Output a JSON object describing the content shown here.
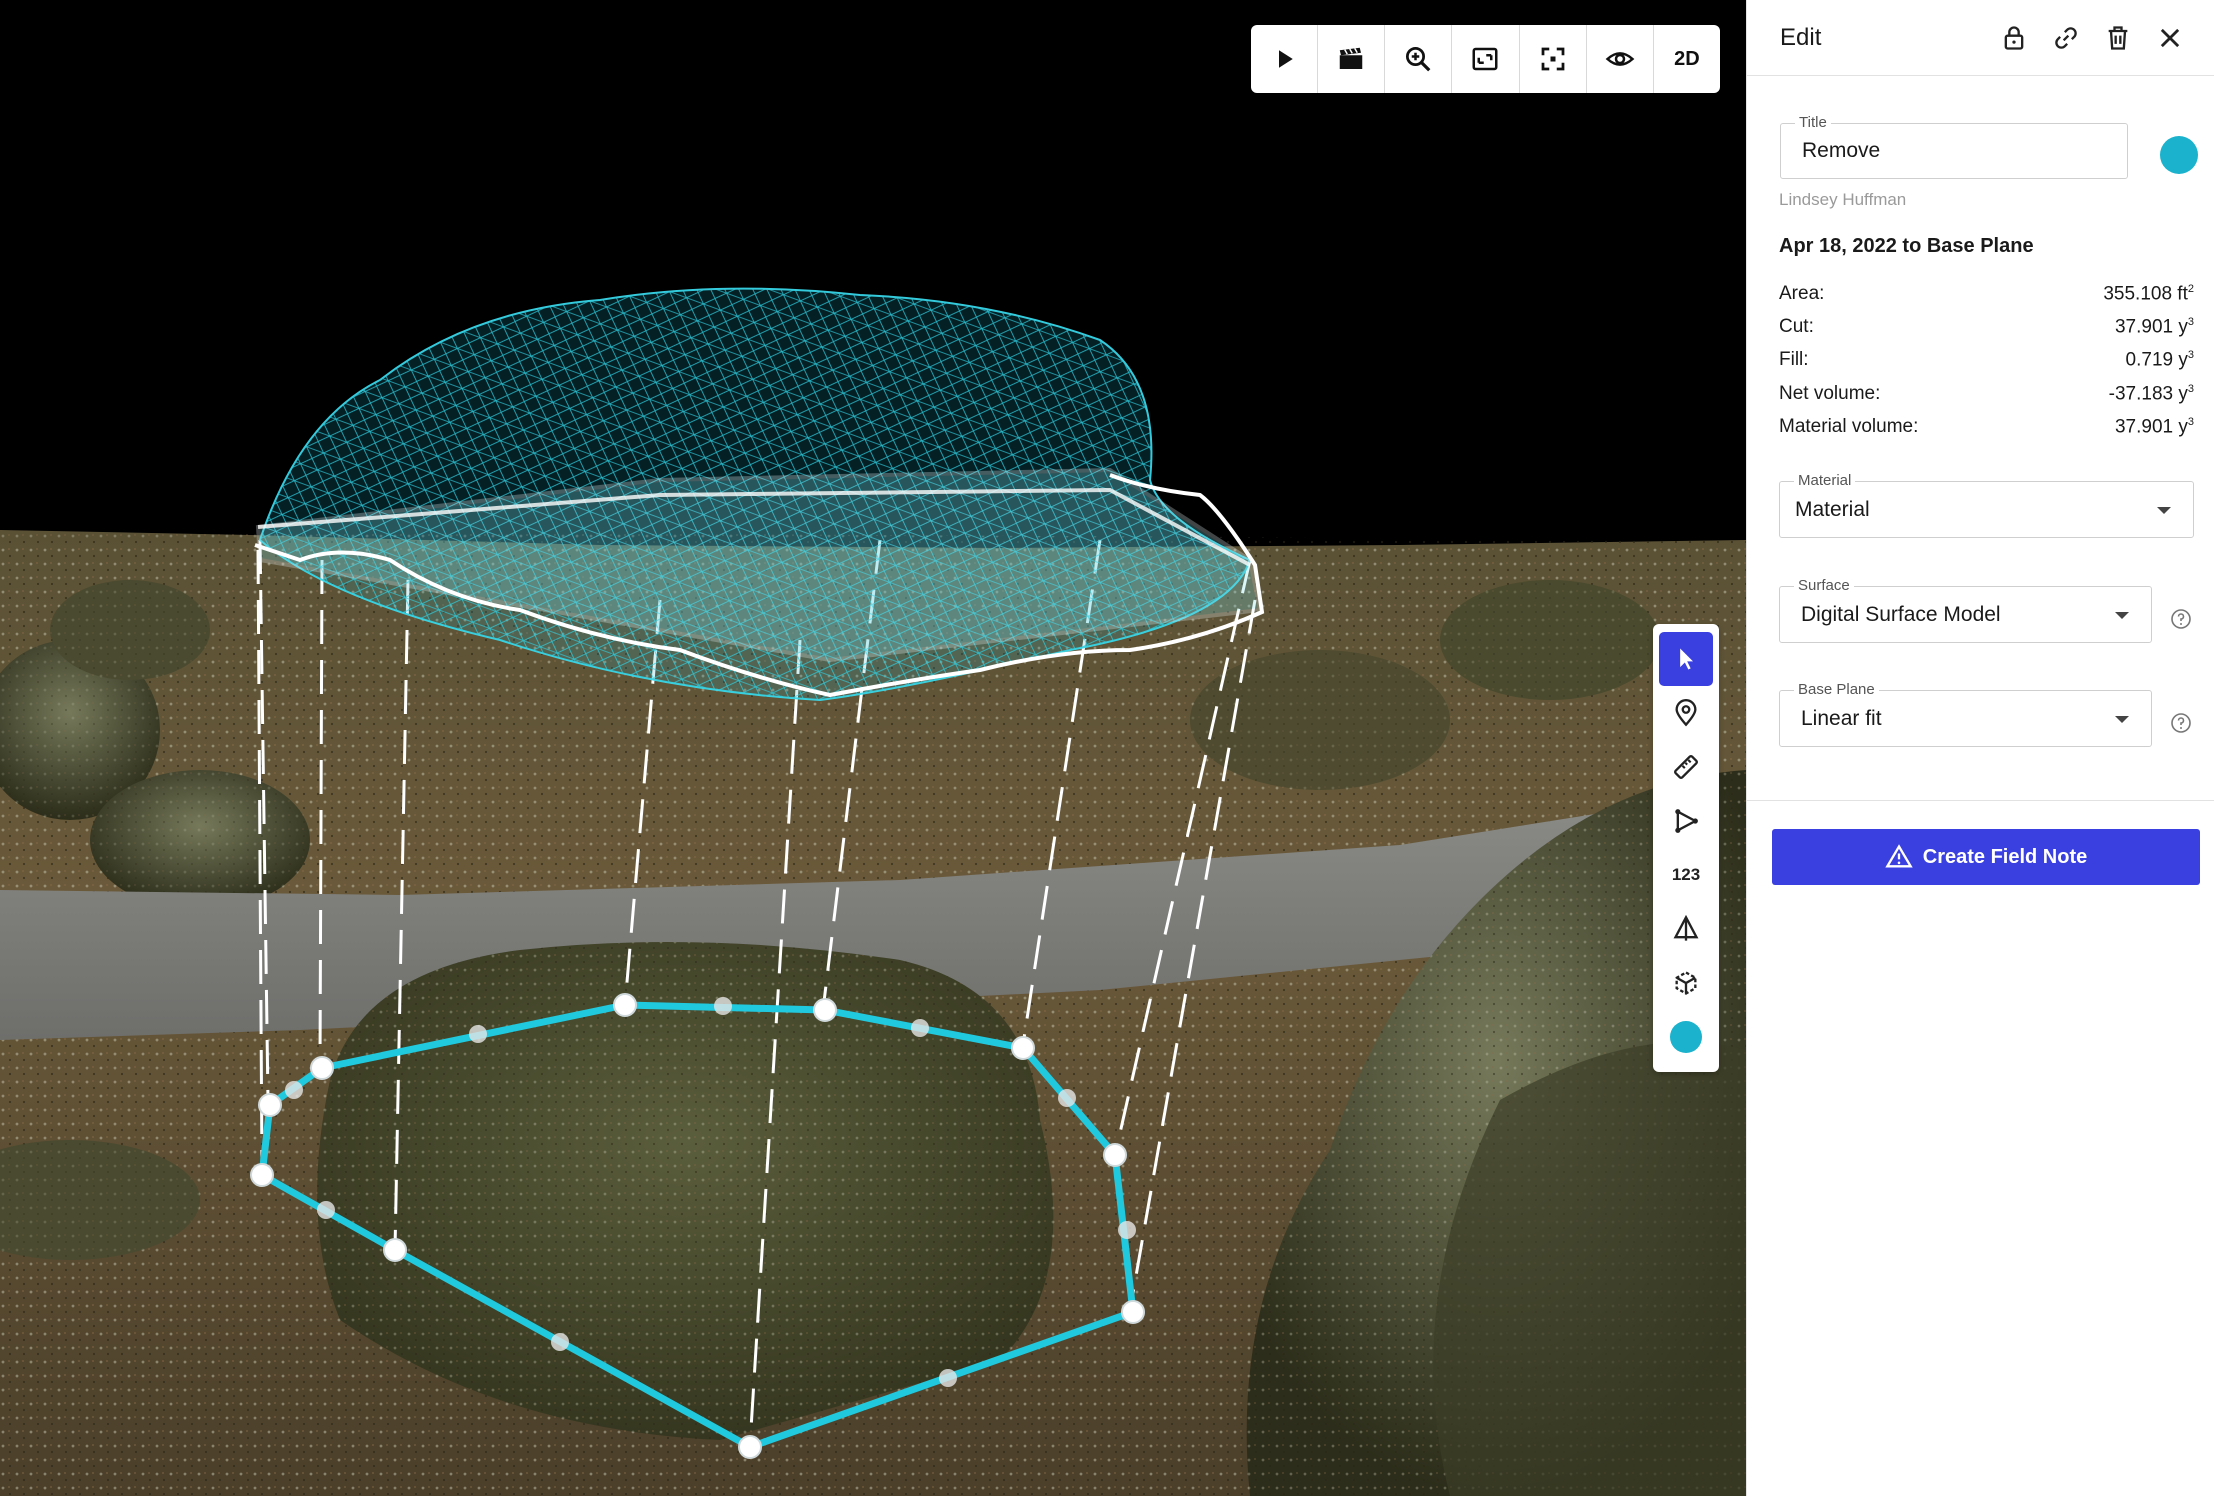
{
  "toolbar": {
    "buttons": [
      {
        "name": "play-button",
        "icon": "play-icon"
      },
      {
        "name": "flythrough-button",
        "icon": "clapperboard-icon"
      },
      {
        "name": "zoom-button",
        "icon": "zoom-in-icon"
      },
      {
        "name": "fit-view-button",
        "icon": "fit-view-icon"
      },
      {
        "name": "fullscreen-button",
        "icon": "fullscreen-icon"
      },
      {
        "name": "visibility-button",
        "icon": "eye-icon"
      }
    ],
    "mode_label": "2D"
  },
  "tools": {
    "items": [
      {
        "name": "select-tool",
        "icon": "cursor-icon",
        "active": true
      },
      {
        "name": "pin-tool",
        "icon": "map-pin-icon"
      },
      {
        "name": "measure-tool",
        "icon": "ruler-icon"
      },
      {
        "name": "polyline-tool",
        "icon": "polyline-icon"
      },
      {
        "name": "elevation-tool",
        "label": "123"
      },
      {
        "name": "volume-tool",
        "icon": "pyramid-icon"
      },
      {
        "name": "cube-tool",
        "icon": "cube-icon"
      }
    ],
    "color": "#1ab2cc"
  },
  "panel": {
    "title": "Edit",
    "header_icons": [
      "lock-icon",
      "link-icon",
      "trash-icon",
      "close-icon"
    ],
    "title_field": {
      "label": "Title",
      "value": "Remove"
    },
    "color": "#1ab2cc",
    "author": "Lindsey Huffman",
    "comparison": "Apr 18, 2022 to Base Plane",
    "stats": [
      {
        "label": "Area:",
        "value": "355.108 ft",
        "unit_sup": "2"
      },
      {
        "label": "Cut:",
        "value": "37.901 y",
        "unit_sup": "3"
      },
      {
        "label": "Fill:",
        "value": "0.719 y",
        "unit_sup": "3"
      },
      {
        "label": "Net volume:",
        "value": "-37.183 y",
        "unit_sup": "3"
      },
      {
        "label": "Material volume:",
        "value": "37.901 y",
        "unit_sup": "3"
      }
    ],
    "material": {
      "label": "Material",
      "value": "Material"
    },
    "surface": {
      "label": "Surface",
      "value": "Digital Surface Model"
    },
    "base_plane": {
      "label": "Base Plane",
      "value": "Linear fit"
    },
    "create_button": "Create Field Note"
  },
  "colors": {
    "accent": "#3a3fe0",
    "measure": "#21c9de"
  }
}
